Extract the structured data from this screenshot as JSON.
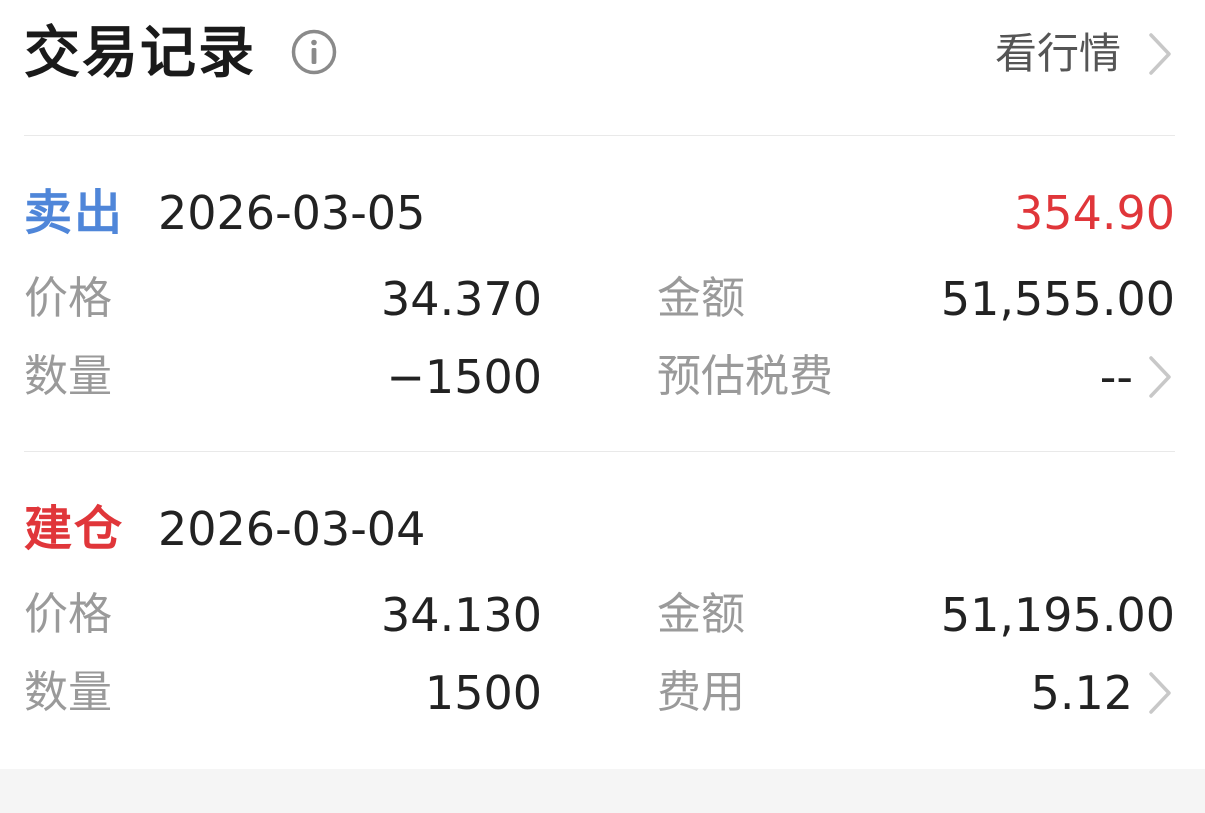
{
  "header": {
    "title": "交易记录",
    "market_link_label": "看行情"
  },
  "colors": {
    "sell": "#4f86d9",
    "open": "#e0363a",
    "profit": "#e0363a"
  },
  "records": [
    {
      "action": "卖出",
      "date": "2026-03-05",
      "profit": "354.90",
      "price_label": "价格",
      "price": "34.370",
      "amount_label": "金额",
      "amount": "51,555.00",
      "quantity_label": "数量",
      "quantity": "−1500",
      "fee_label": "预估税费",
      "fee": "--"
    },
    {
      "action": "建仓",
      "date": "2026-03-04",
      "price_label": "价格",
      "price": "34.130",
      "amount_label": "金额",
      "amount": "51,195.00",
      "quantity_label": "数量",
      "quantity": "1500",
      "fee_label": "费用",
      "fee": "5.12"
    }
  ]
}
